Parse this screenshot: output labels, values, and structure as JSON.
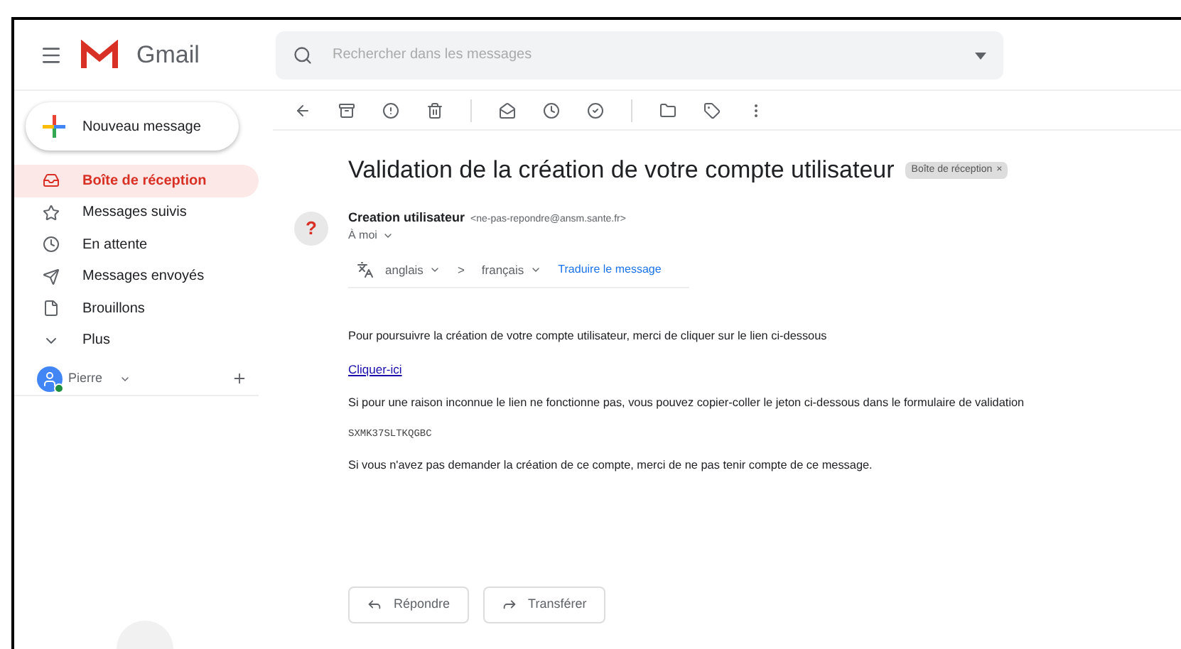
{
  "header": {
    "app_name": "Gmail",
    "search": {
      "placeholder": "Rechercher dans les messages"
    }
  },
  "compose": {
    "label": "Nouveau message"
  },
  "sidebar": {
    "items": [
      {
        "label": "Boîte de réception",
        "selected": true
      },
      {
        "label": "Messages suivis",
        "selected": false
      },
      {
        "label": "En attente",
        "selected": false
      },
      {
        "label": "Messages envoyés",
        "selected": false
      },
      {
        "label": "Brouillons",
        "selected": false
      },
      {
        "label": "Plus",
        "selected": false
      }
    ]
  },
  "hangouts": {
    "user": "Pierre",
    "online": true
  },
  "message": {
    "subject": "Validation de la création de votre compte utilisateur",
    "label_chip": "Boîte de réception",
    "label_chip_close": "×",
    "sender_avatar": "?",
    "sender_name": "Creation utilisateur",
    "sender_email": "<ne-pas-repondre@ansm.sante.fr>",
    "recipient": "À moi",
    "translate": {
      "from": "anglais",
      "arrow": ">",
      "to": "français",
      "action": "Traduire le message"
    },
    "body": [
      {
        "kind": "text",
        "text": "Pour poursuivre la création de votre compte utilisateur, merci de cliquer sur le lien ci-dessous"
      },
      {
        "kind": "link",
        "text": "Cliquer-ici"
      },
      {
        "kind": "text",
        "text": "Si pour une raison inconnue le lien ne fonctionne pas, vous pouvez copier-coller le jeton ci-dessous dans le formulaire de validation"
      },
      {
        "kind": "code",
        "text": "SXMK37SLTKQGBC"
      },
      {
        "kind": "text",
        "text": "Si vous n'avez pas demander la création de ce compte, merci de ne pas tenir compte de ce message."
      }
    ],
    "actions": [
      "Répondre",
      "Transférer"
    ]
  }
}
